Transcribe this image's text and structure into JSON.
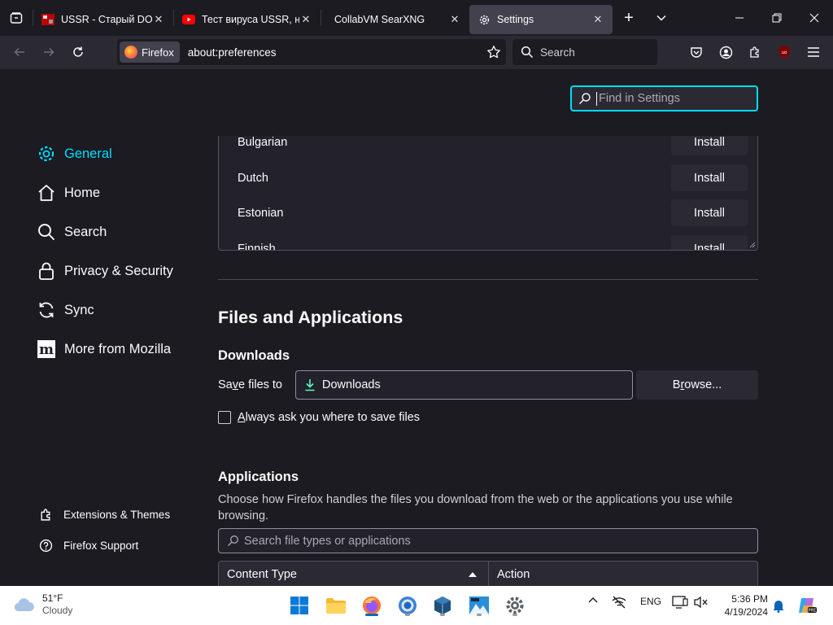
{
  "tabs": [
    {
      "title": "USSR - Старый DOS. А",
      "close": "✕"
    },
    {
      "title": "Тест вируса USSR, на р",
      "close": "✕"
    },
    {
      "title": "CollabVM SearXNG",
      "close": "✕"
    },
    {
      "title": "Settings",
      "close": "✕"
    }
  ],
  "tabstrip": {
    "new_tab": "+"
  },
  "navbar": {
    "identity_label": "Firefox",
    "url": "about:preferences",
    "search_placeholder": "Search"
  },
  "settings": {
    "find_placeholder": "Find in Settings",
    "nav": [
      {
        "label": "General"
      },
      {
        "label": "Home"
      },
      {
        "label": "Search"
      },
      {
        "label": "Privacy & Security"
      },
      {
        "label": "Sync"
      },
      {
        "label": "More from Mozilla"
      }
    ],
    "footer": [
      {
        "label": "Extensions & Themes"
      },
      {
        "label": "Firefox Support"
      }
    ],
    "languages": [
      {
        "name": "Bulgarian",
        "action": "Install"
      },
      {
        "name": "Dutch",
        "action": "Install"
      },
      {
        "name": "Estonian",
        "action": "Install"
      },
      {
        "name": "Finnish",
        "action": "Install"
      }
    ],
    "files_heading": "Files and Applications",
    "downloads_heading": "Downloads",
    "save_files_prefix": "Sa",
    "save_files_key": "v",
    "save_files_suffix": "e files to",
    "download_folder": "Downloads",
    "browse_prefix": "B",
    "browse_key": "r",
    "browse_suffix": "owse...",
    "always_ask_key": "A",
    "always_ask_rest": "lways ask you where to save files",
    "applications_heading": "Applications",
    "applications_desc": "Choose how Firefox handles the files you download from the web or the applications you use while browsing.",
    "app_search_placeholder": "Search file types or applications",
    "col_content_type": "Content Type",
    "col_action": "Action"
  },
  "taskbar": {
    "temperature": "51°F",
    "condition": "Cloudy",
    "language": "ENG",
    "time": "5:36 PM",
    "date": "4/19/2024"
  },
  "colors": {
    "accent": "#00ddff",
    "background": "#1c1b22",
    "toolbar": "#2b2a33"
  }
}
